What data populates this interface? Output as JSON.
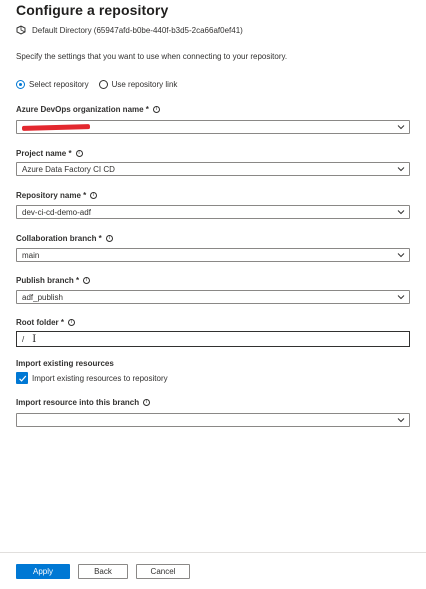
{
  "panel": {
    "title": "Configure a repository",
    "directory": "Default Directory (65947afd-b0be-440f-b3d5-2ca66af0ef41)",
    "description": "Specify the settings that you want to use when connecting to your repository."
  },
  "repo_mode": {
    "options": [
      {
        "label": "Select repository",
        "selected": true
      },
      {
        "label": "Use repository link",
        "selected": false
      }
    ]
  },
  "fields": {
    "org": {
      "label": "Azure DevOps organization name *",
      "value": ""
    },
    "project": {
      "label": "Project name *",
      "value": "Azure Data Factory CI CD"
    },
    "repository": {
      "label": "Repository name *",
      "value": "dev-ci-cd-demo-adf"
    },
    "collab_branch": {
      "label": "Collaboration branch *",
      "value": "main"
    },
    "publish_branch": {
      "label": "Publish branch *",
      "value": "adf_publish"
    },
    "root_folder": {
      "label": "Root folder *",
      "value": "/"
    },
    "import_branch": {
      "label": "Import resource into this branch",
      "value": ""
    }
  },
  "import_existing": {
    "heading": "Import existing resources",
    "checkbox_label": "Import existing resources to repository",
    "checked": true
  },
  "footer": {
    "apply_label": "Apply",
    "back_label": "Back",
    "cancel_label": "Cancel"
  },
  "colors": {
    "accent": "#0078d4",
    "redaction": "#e3282f"
  },
  "icons": {
    "directory": "directory-icon",
    "info": "info-icon",
    "dropdown": "chevron-down-icon",
    "checkmark": "checkmark-icon"
  }
}
